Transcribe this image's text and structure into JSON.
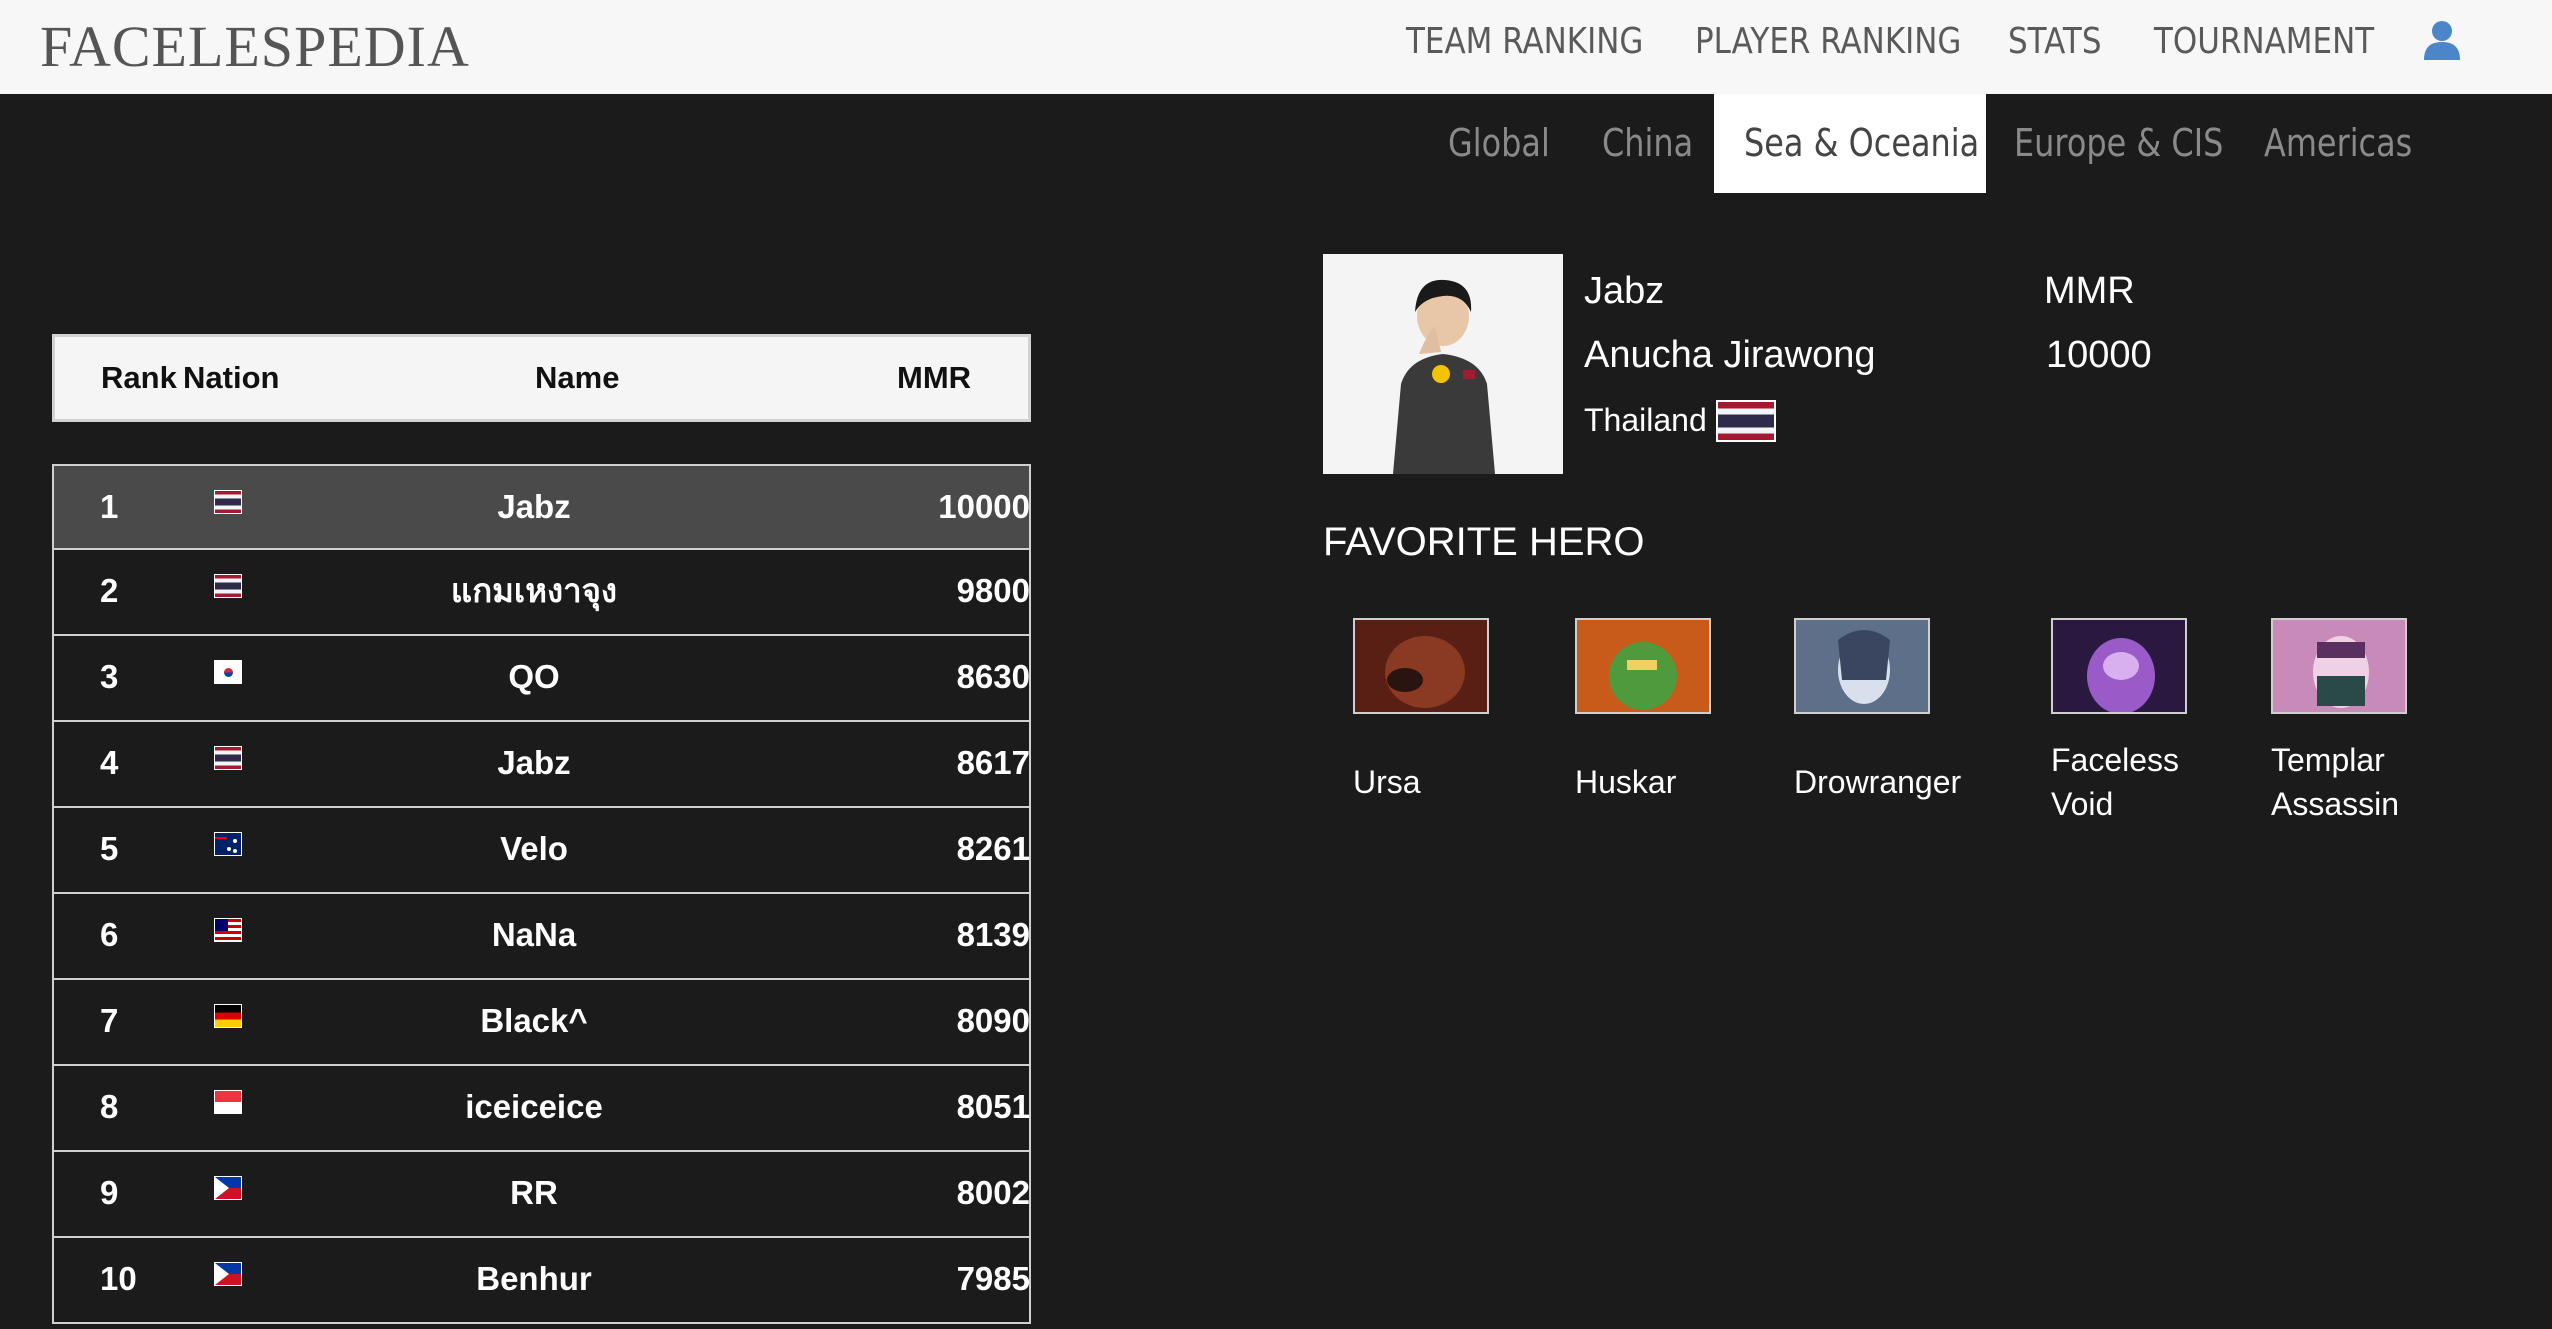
{
  "header": {
    "logo": "FACELESPEDIA",
    "nav": [
      "TEAM RANKING",
      "PLAYER RANKING",
      "STATS",
      "TOURNAMENT"
    ],
    "user_icon": "user-icon"
  },
  "regions": {
    "tabs": [
      "Global",
      "China",
      "Sea & Oceania",
      "Europe & CIS",
      "Americas"
    ],
    "active": "Sea & Oceania"
  },
  "ranking": {
    "headers": {
      "rank": "Rank",
      "nation": "Nation",
      "name": "Name",
      "mmr": "MMR"
    },
    "rows": [
      {
        "rank": "1",
        "flag": "th",
        "name": "Jabz",
        "mmr": "10000"
      },
      {
        "rank": "2",
        "flag": "th",
        "name": "แกมเหงาจุง",
        "mmr": "9800"
      },
      {
        "rank": "3",
        "flag": "kr",
        "name": "QO",
        "mmr": "8630"
      },
      {
        "rank": "4",
        "flag": "th",
        "name": "Jabz",
        "mmr": "8617"
      },
      {
        "rank": "5",
        "flag": "au",
        "name": "Velo",
        "mmr": "8261"
      },
      {
        "rank": "6",
        "flag": "my",
        "name": "NaNa",
        "mmr": "8139"
      },
      {
        "rank": "7",
        "flag": "de",
        "name": "Black^",
        "mmr": "8090"
      },
      {
        "rank": "8",
        "flag": "sg",
        "name": "iceiceice",
        "mmr": "8051"
      },
      {
        "rank": "9",
        "flag": "ph",
        "name": "RR",
        "mmr": "8002"
      },
      {
        "rank": "10",
        "flag": "ph",
        "name": "Benhur",
        "mmr": "7985"
      }
    ],
    "selected_rank": "1"
  },
  "player": {
    "nickname": "Jabz",
    "full_name": "Anucha Jirawong",
    "country": "Thailand",
    "mmr_label": "MMR",
    "mmr_value": "10000"
  },
  "favorite_heroes": {
    "title": "FAVORITE HERO",
    "heroes": [
      {
        "name_lines": [
          "Ursa"
        ],
        "color": "#7a2a1a"
      },
      {
        "name_lines": [
          "Huskar"
        ],
        "color": "#3f8a3a"
      },
      {
        "name_lines": [
          "Drowranger"
        ],
        "color": "#8fa2be"
      },
      {
        "name_lines": [
          "Faceless",
          "Void"
        ],
        "color": "#6a3a8a"
      },
      {
        "name_lines": [
          "Templar",
          "Assassin"
        ],
        "color": "#d9b6d6"
      }
    ]
  }
}
